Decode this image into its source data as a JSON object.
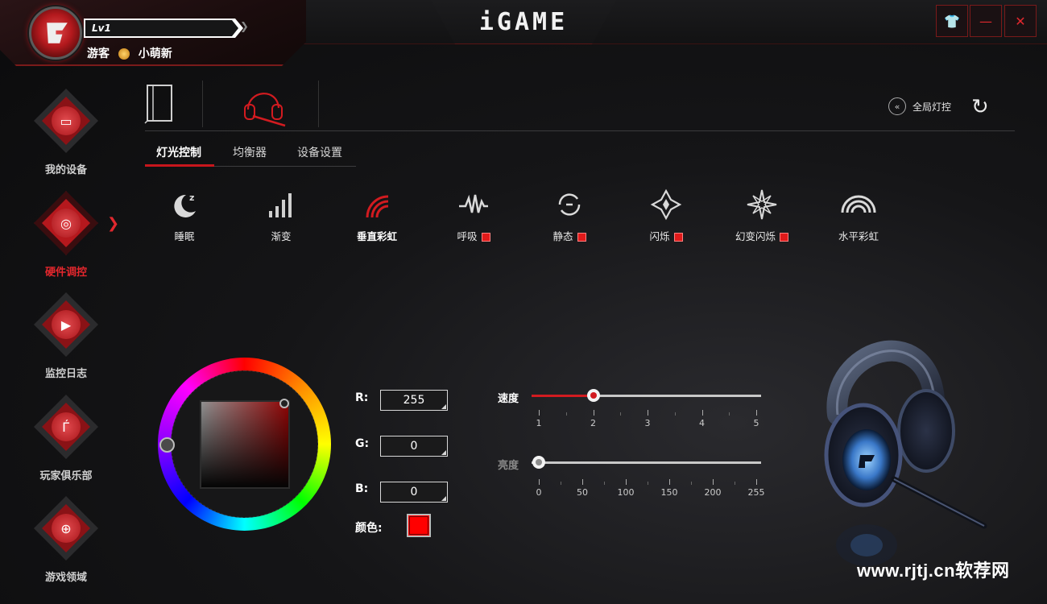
{
  "header": {
    "level": "Lv1",
    "user_role": "游客",
    "user_name": "小萌新",
    "logo": "iGAME",
    "window_controls": [
      "skin-icon",
      "minimize-icon",
      "close-icon"
    ]
  },
  "sidebar": {
    "items": [
      {
        "label": "我的设备",
        "icon": "monitor-icon",
        "active": false
      },
      {
        "label": "硬件调控",
        "icon": "dpad-icon",
        "active": true
      },
      {
        "label": "监控日志",
        "icon": "play-record-icon",
        "active": false
      },
      {
        "label": "玩家俱乐部",
        "icon": "igame-logo-icon",
        "active": false
      },
      {
        "label": "游戏领域",
        "icon": "gamepad-icon",
        "active": false
      }
    ]
  },
  "devices": {
    "items": [
      {
        "name": "pc-case-icon",
        "active": false
      },
      {
        "name": "headset-icon",
        "active": true
      }
    ],
    "global_light_label": "全局灯控"
  },
  "subtabs": [
    {
      "label": "灯光控制",
      "active": true
    },
    {
      "label": "均衡器",
      "active": false
    },
    {
      "label": "设备设置",
      "active": false
    }
  ],
  "effects": [
    {
      "label": "睡眠",
      "icon": "moon-sleep-icon",
      "color_square": false,
      "active": false
    },
    {
      "label": "渐变",
      "icon": "signal-bars-icon",
      "color_square": false,
      "active": false
    },
    {
      "label": "垂直彩虹",
      "icon": "vertical-rainbow-icon",
      "color_square": false,
      "active": true
    },
    {
      "label": "呼吸",
      "icon": "pulse-wave-icon",
      "color_square": true,
      "active": false
    },
    {
      "label": "静态",
      "icon": "circle-static-icon",
      "color_square": true,
      "active": false
    },
    {
      "label": "闪烁",
      "icon": "star-blink-icon",
      "color_square": true,
      "active": false
    },
    {
      "label": "幻变闪烁",
      "icon": "sparkle-icon",
      "color_square": true,
      "active": false
    },
    {
      "label": "水平彩虹",
      "icon": "horizontal-rainbow-icon",
      "color_square": false,
      "active": false
    }
  ],
  "color": {
    "r_label": "R:",
    "g_label": "G:",
    "b_label": "B:",
    "r": "255",
    "g": "0",
    "b": "0",
    "color_label": "颜色:",
    "swatch": "#ff0000"
  },
  "sliders": {
    "speed": {
      "label": "速度",
      "value": 2,
      "min": 1,
      "max": 5,
      "ticks": [
        "1",
        "2",
        "3",
        "4",
        "5"
      ]
    },
    "brightness": {
      "label": "亮度",
      "value": 0,
      "min": 0,
      "max": 255,
      "ticks": [
        "0",
        "50",
        "100",
        "150",
        "200",
        "255"
      ]
    }
  },
  "watermark": "www.rjtj.cn软荐网",
  "colors": {
    "accent": "#d21b20",
    "background": "#151517"
  }
}
